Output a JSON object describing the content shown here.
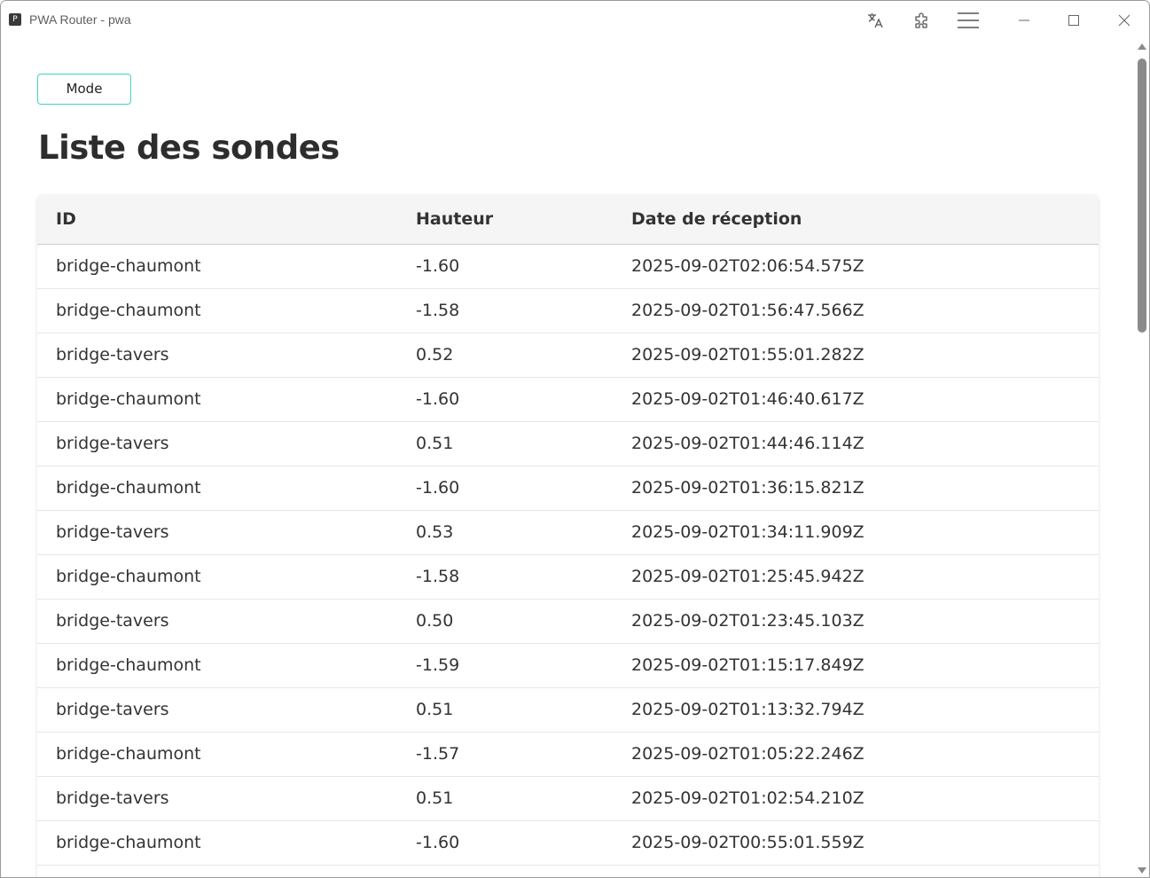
{
  "window": {
    "title": "PWA Router - pwa",
    "app_icon_letter": "P"
  },
  "titlebar_icons": [
    "translate-icon",
    "extensions-icon",
    "menu-icon",
    "minimize-icon",
    "maximize-icon",
    "close-icon"
  ],
  "toolbar": {
    "mode_label": "Mode"
  },
  "page": {
    "title": "Liste des sondes"
  },
  "table": {
    "headers": [
      "ID",
      "Hauteur",
      "Date de réception"
    ],
    "rows": [
      [
        "bridge-chaumont",
        "-1.60",
        "2025-09-02T02:06:54.575Z"
      ],
      [
        "bridge-chaumont",
        "-1.58",
        "2025-09-02T01:56:47.566Z"
      ],
      [
        "bridge-tavers",
        "0.52",
        "2025-09-02T01:55:01.282Z"
      ],
      [
        "bridge-chaumont",
        "-1.60",
        "2025-09-02T01:46:40.617Z"
      ],
      [
        "bridge-tavers",
        "0.51",
        "2025-09-02T01:44:46.114Z"
      ],
      [
        "bridge-chaumont",
        "-1.60",
        "2025-09-02T01:36:15.821Z"
      ],
      [
        "bridge-tavers",
        "0.53",
        "2025-09-02T01:34:11.909Z"
      ],
      [
        "bridge-chaumont",
        "-1.58",
        "2025-09-02T01:25:45.942Z"
      ],
      [
        "bridge-tavers",
        "0.50",
        "2025-09-02T01:23:45.103Z"
      ],
      [
        "bridge-chaumont",
        "-1.59",
        "2025-09-02T01:15:17.849Z"
      ],
      [
        "bridge-tavers",
        "0.51",
        "2025-09-02T01:13:32.794Z"
      ],
      [
        "bridge-chaumont",
        "-1.57",
        "2025-09-02T01:05:22.246Z"
      ],
      [
        "bridge-tavers",
        "0.51",
        "2025-09-02T01:02:54.210Z"
      ],
      [
        "bridge-chaumont",
        "-1.60",
        "2025-09-02T00:55:01.559Z"
      ]
    ]
  },
  "colors": {
    "mode_button_border": "#3fd3c2",
    "text": "#333333",
    "header_bg": "#f5f5f5",
    "scrollbar": "#8a8a8a"
  }
}
